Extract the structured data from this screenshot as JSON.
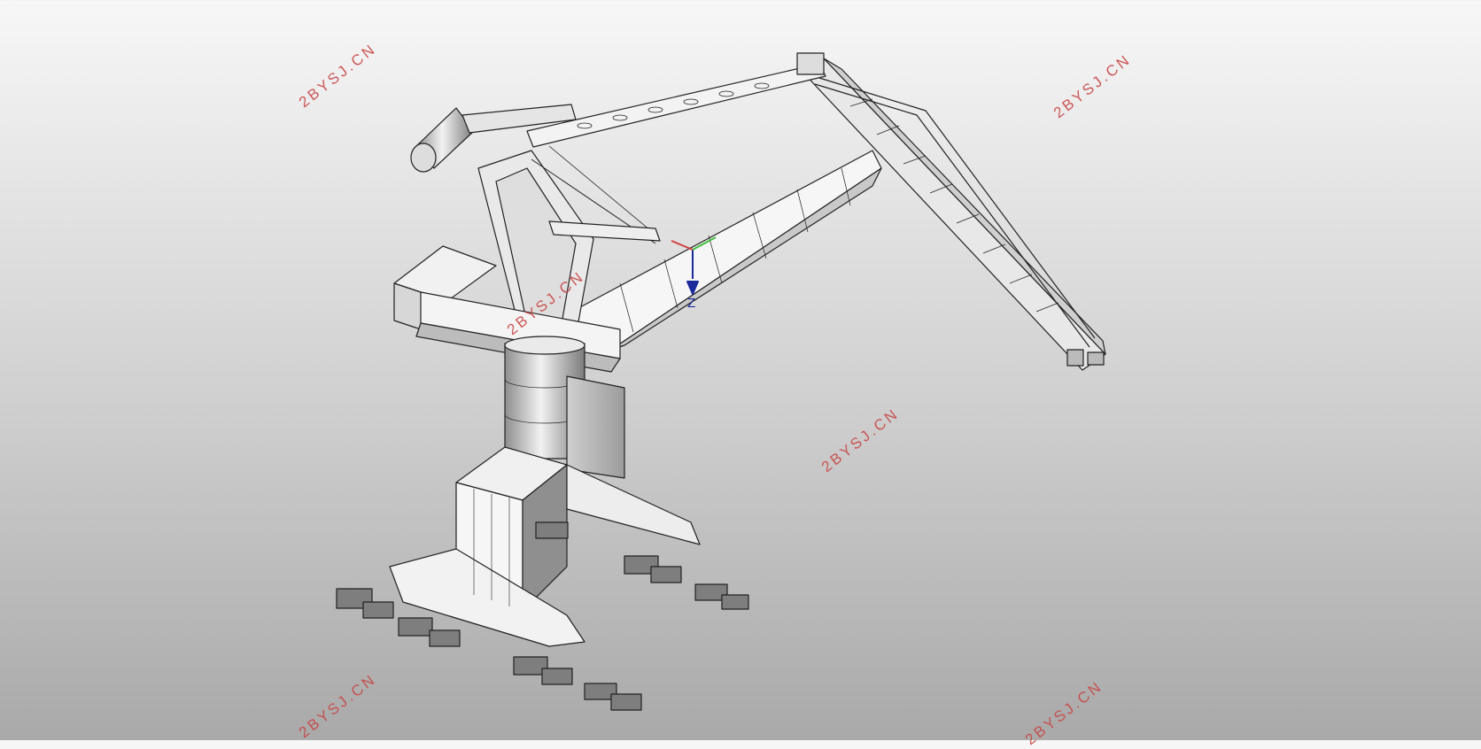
{
  "watermarks": [
    "2BYSJ.CN",
    "2BYSJ.CN",
    "2BYSJ.CN",
    "2BYSJ.CN",
    "2BYSJ.CN",
    "2BYSJ.CN"
  ],
  "axis": {
    "z_label": "Z"
  },
  "colors": {
    "watermark": "#c84848",
    "axis_z": "#1a2a9a",
    "axis_y": "#3fbf3f",
    "axis_x": "#d04040"
  }
}
